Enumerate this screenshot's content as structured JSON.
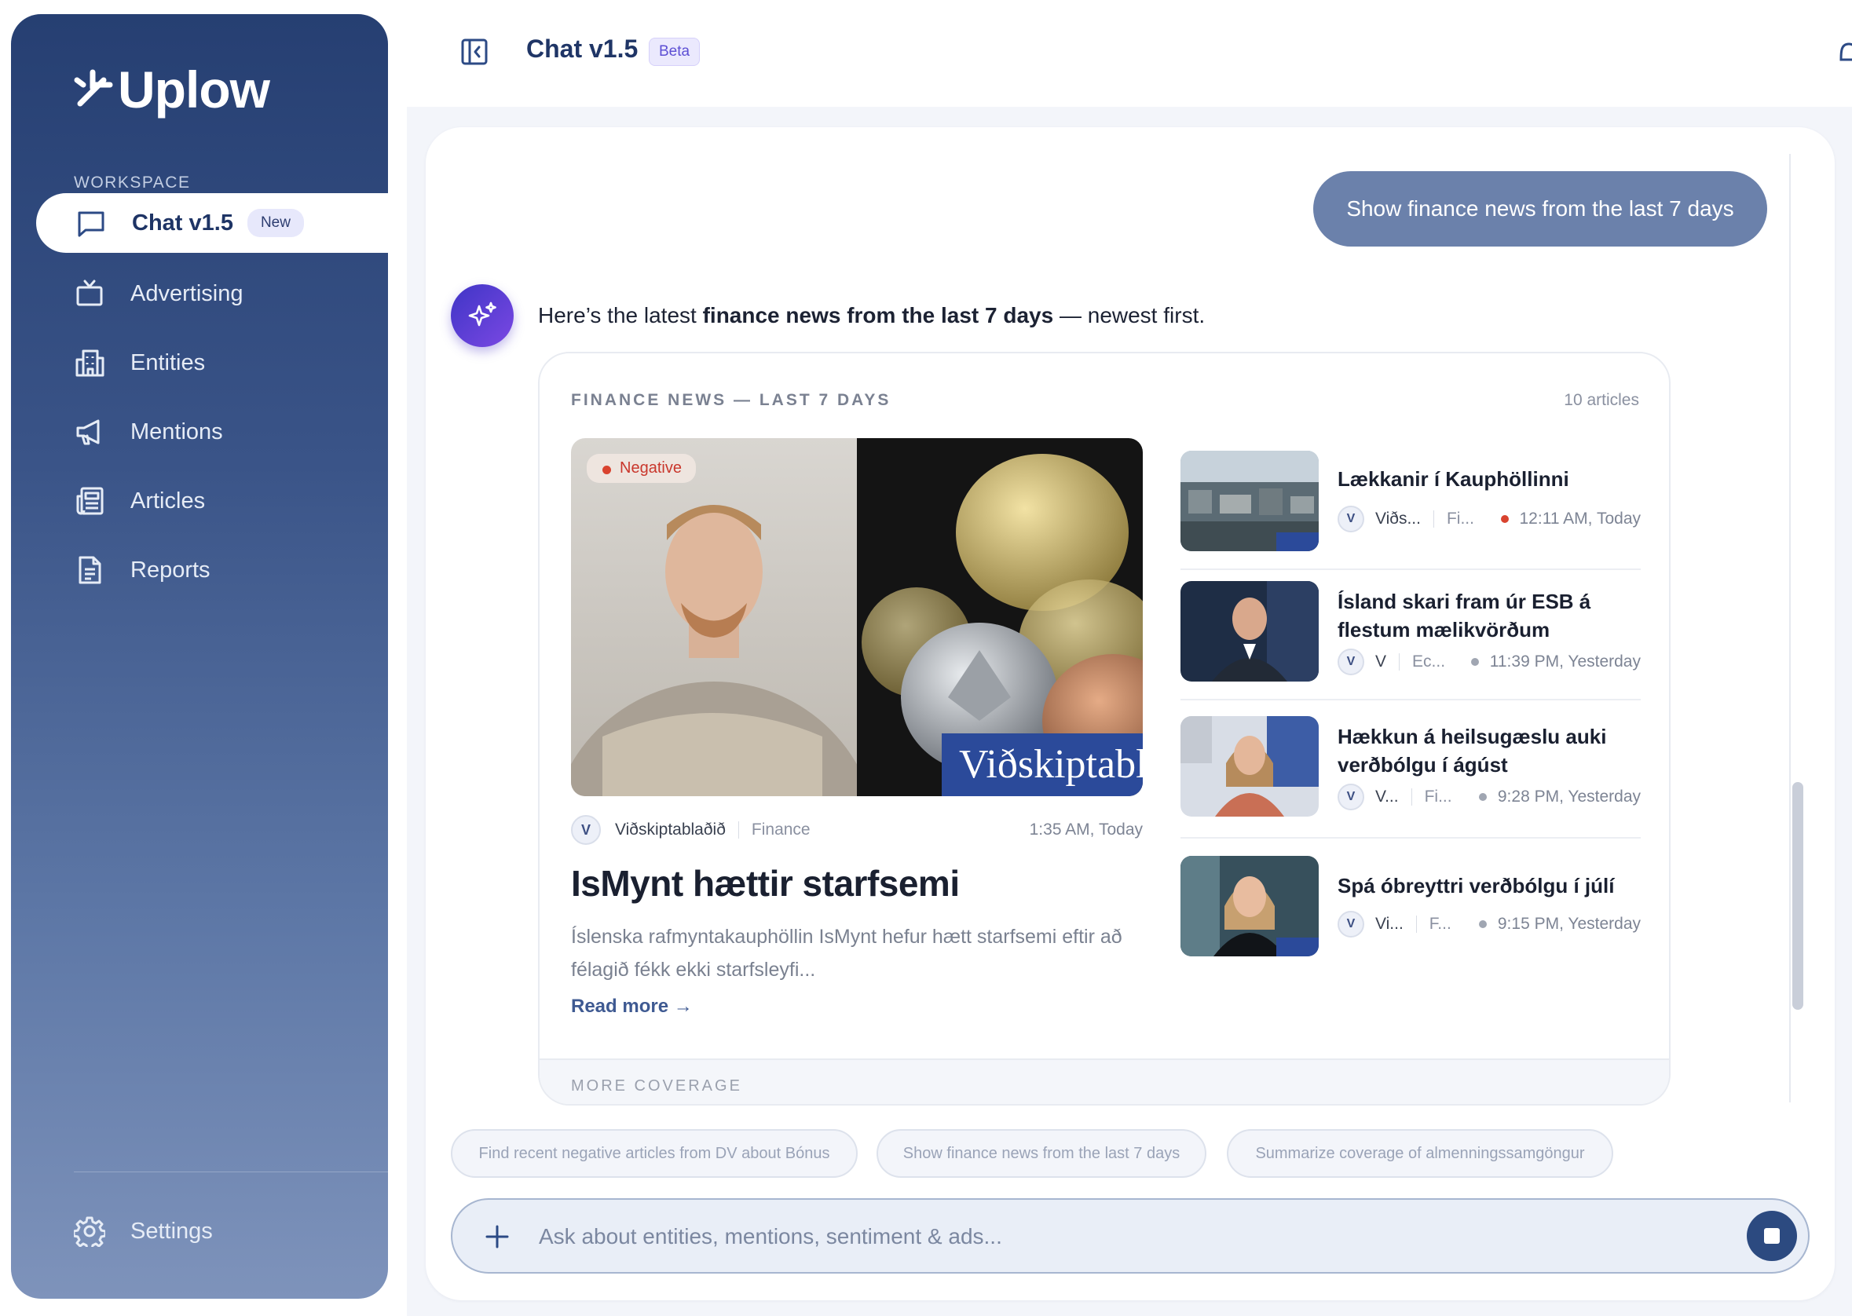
{
  "app": {
    "brand": "Uplow",
    "workspace_label": "WORKSPACE"
  },
  "sidebar": {
    "items": [
      {
        "label": "Chat v1.5",
        "badge": "New",
        "icon": "chat-bubble-icon",
        "active": true
      },
      {
        "label": "Advertising",
        "icon": "tv-icon"
      },
      {
        "label": "Entities",
        "icon": "building-icon"
      },
      {
        "label": "Mentions",
        "icon": "megaphone-icon"
      },
      {
        "label": "Articles",
        "icon": "newspaper-icon"
      },
      {
        "label": "Reports",
        "icon": "document-icon"
      }
    ],
    "settings_label": "Settings"
  },
  "header": {
    "title": "Chat v1.5",
    "badge": "Beta"
  },
  "chat": {
    "user_message": "Show finance news from the last 7 days",
    "ai_intro": "Here’s the latest ",
    "ai_bold": "finance news from the last 7 days",
    "ai_outro": " — newest first."
  },
  "news_card": {
    "title": "FINANCE NEWS — LAST 7 DAYS",
    "count": "10 articles",
    "featured": {
      "sentiment": "Negative",
      "image_text": "Viðskiptablað",
      "source_initial": "V",
      "source": "Viðskiptablaðið",
      "category": "Finance",
      "time": "1:35 AM, Today",
      "headline": "IsMynt hættir starfsemi",
      "excerpt": "Íslenska rafmyntakauphöllin IsMynt hefur hætt starfsemi eftir að félagið fékk ekki starfsleyfi...",
      "read_more": "Read more →"
    },
    "articles": [
      {
        "headline": "Lækkanir í Kauphöllinni",
        "source_initial": "V",
        "source": "Viðs...",
        "category": "Fi...",
        "time": "12:11 AM, Today",
        "status_color": "#d9432f"
      },
      {
        "headline": "Ísland skari fram úr ESB á flestum mælikvörðum",
        "source_initial": "V",
        "source": "V",
        "category": "Ec...",
        "time": "11:39 PM, Yesterday",
        "status_color": "#a0a6b2"
      },
      {
        "headline": "Hækkun á heilsugæslu auki verðbólgu í ágúst",
        "source_initial": "V",
        "source": "V...",
        "category": "Fi...",
        "time": "9:28 PM, Yesterday",
        "status_color": "#a0a6b2"
      },
      {
        "headline": "Spá óbreyttri verðbólgu í júlí",
        "source_initial": "V",
        "source": "Vi...",
        "category": "F...",
        "time": "9:15 PM, Yesterday",
        "status_color": "#a0a6b2"
      }
    ],
    "more_coverage": "MORE COVERAGE"
  },
  "suggestions": [
    "Find recent negative articles from DV about Bónus",
    "Show finance news from the last 7 days",
    "Summarize coverage of almenningssamgöngur"
  ],
  "input": {
    "placeholder": "Ask about entities, mentions, sentiment & ads...",
    "value": ""
  },
  "colors": {
    "brand_navy": "#263f72",
    "accent_purple": "#5d4fd4",
    "negative_red": "#d9432f",
    "user_bubble": "#6b81ab"
  }
}
